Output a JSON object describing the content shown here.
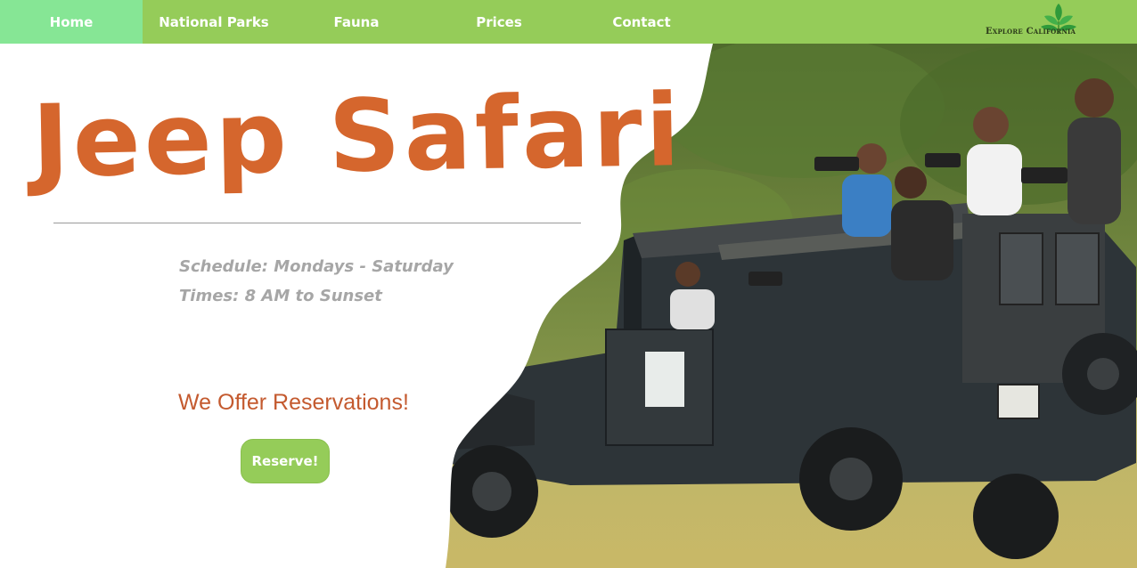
{
  "nav": {
    "items": [
      {
        "label": "Home",
        "active": true
      },
      {
        "label": "National Parks",
        "active": false
      },
      {
        "label": "Fauna",
        "active": false
      },
      {
        "label": "Prices",
        "active": false
      },
      {
        "label": "Contact",
        "active": false
      }
    ],
    "logo_text": "Explore California"
  },
  "hero": {
    "title": "Jeep Safari",
    "schedule_line": "Schedule: Mondays - Saturday",
    "times_line": "Times: 8 AM to Sunset",
    "reservation_caption": "We Offer Reservations!",
    "reserve_button": "Reserve!"
  },
  "colors": {
    "nav_bg": "#95cc59",
    "nav_active_bg": "#86e695",
    "title": "#d5662d",
    "caption": "#c45a2f",
    "muted_text": "#a6a6a6"
  },
  "icons": [
    "leaf-logo-icon"
  ]
}
